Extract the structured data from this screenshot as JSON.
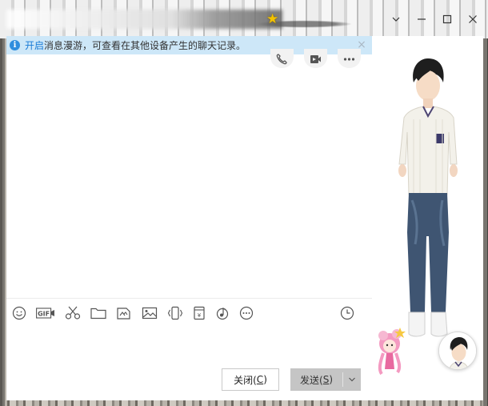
{
  "window": {
    "controls": {
      "dropdown_glyph": "⌵",
      "minimize_glyph": "—",
      "maximize_glyph": "□",
      "close_glyph": "✕"
    }
  },
  "notice": {
    "link_text": "开启",
    "message": "消息漫游，可查看在其他设备产生的聊天记录。",
    "icon": "info-icon",
    "close_icon": "close-icon"
  },
  "call_buttons": [
    {
      "icon": "phone-icon"
    },
    {
      "icon": "video-call-icon"
    },
    {
      "icon": "more-icon"
    }
  ],
  "toolbar": {
    "items": [
      {
        "icon": "emoji-icon"
      },
      {
        "icon": "gif-icon",
        "text": "GIF"
      },
      {
        "icon": "scissors-icon"
      },
      {
        "icon": "folder-icon"
      },
      {
        "icon": "screenshot-doc-icon"
      },
      {
        "icon": "image-icon"
      },
      {
        "icon": "shake-icon"
      },
      {
        "icon": "red-packet-icon"
      },
      {
        "icon": "music-icon"
      },
      {
        "icon": "more-options-icon"
      }
    ],
    "history_icon": "clock-icon"
  },
  "buttons": {
    "close_label": "关闭(",
    "close_key": "C",
    "close_suffix": ")",
    "send_label": "发送(",
    "send_key": "S",
    "send_suffix": ")"
  },
  "colors": {
    "notice_bg": "#cde7f8",
    "link": "#1a7bd6",
    "send_bg": "#c5c5c5"
  }
}
